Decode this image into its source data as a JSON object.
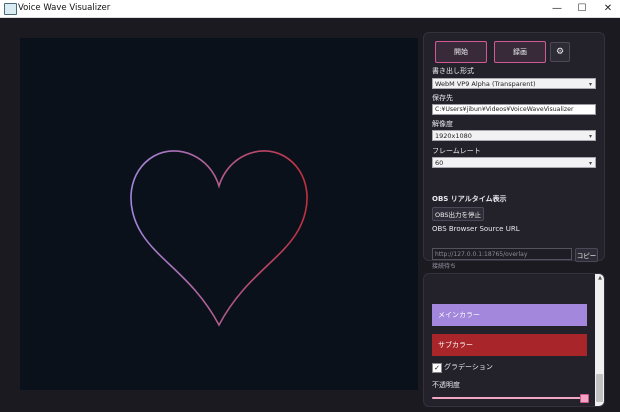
{
  "window": {
    "title": "Voice Wave Visualizer",
    "minimize": "—",
    "maximize": "☐",
    "close": "✕"
  },
  "controls": {
    "start_label": "開始",
    "record_label": "録画",
    "gear_symbol": "⚙"
  },
  "settings": {
    "format_label": "書き出し形式",
    "format_value": "WebM VP9 Alpha (Transparent)",
    "save_label": "保存先",
    "save_path": "C:¥Users¥jibun¥Videos¥VoiceWaveVisualizer",
    "resolution_label": "解像度",
    "resolution_value": "1920x1080",
    "framerate_label": "フレームレート",
    "framerate_value": "60",
    "obs_title": "OBS リアルタイム表示",
    "obs_stop_label": "OBS出力を停止",
    "obs_url_label": "OBS Browser Source URL",
    "obs_url": "http://127.0.0.1:18765/overlay",
    "copy_label": "コピー",
    "status": "接続待ち"
  },
  "colors_panel": {
    "main_color_label": "メインカラー",
    "main_color": "#a287dc",
    "sub_color_label": "サブカラー",
    "sub_color": "#a8262a",
    "gradient_label": "グラデーション",
    "gradient_checked": true,
    "opacity_label": "不透明度",
    "opacity": 1.0
  },
  "preview": {
    "background": "#0b111b",
    "shape": "heart",
    "gradient_start": "#a287dc",
    "gradient_end": "#c0303f"
  }
}
